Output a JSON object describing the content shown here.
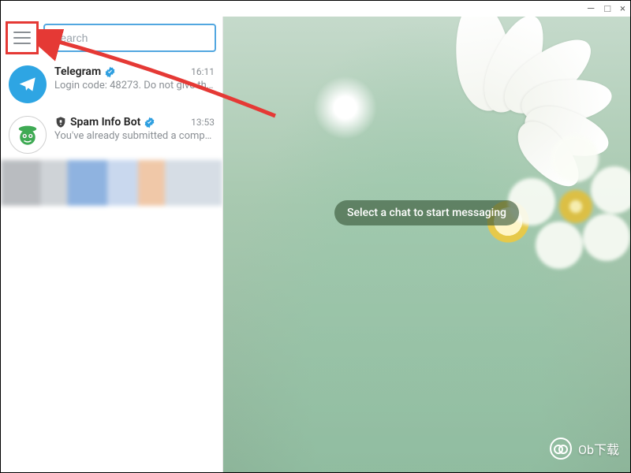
{
  "window": {
    "minimize": "—",
    "maximize": "□",
    "close": "×"
  },
  "search": {
    "placeholder": "Search",
    "value": ""
  },
  "chats": [
    {
      "name": "Telegram",
      "verified": true,
      "time": "16:11",
      "preview": "Login code: 48273. Do not give thi…",
      "avatar": "telegram",
      "bot_prefix": false
    },
    {
      "name": "Spam Info Bot",
      "verified": true,
      "time": "13:53",
      "preview": "You've already submitted a comp…",
      "avatar": "spambot",
      "bot_prefix": true
    }
  ],
  "main": {
    "empty_message": "Select a chat to start messaging"
  },
  "watermark": {
    "text": "Ob下载"
  },
  "colors": {
    "highlight": "#e53935",
    "accent": "#52a7e0",
    "verified": "#2e9fe0"
  }
}
